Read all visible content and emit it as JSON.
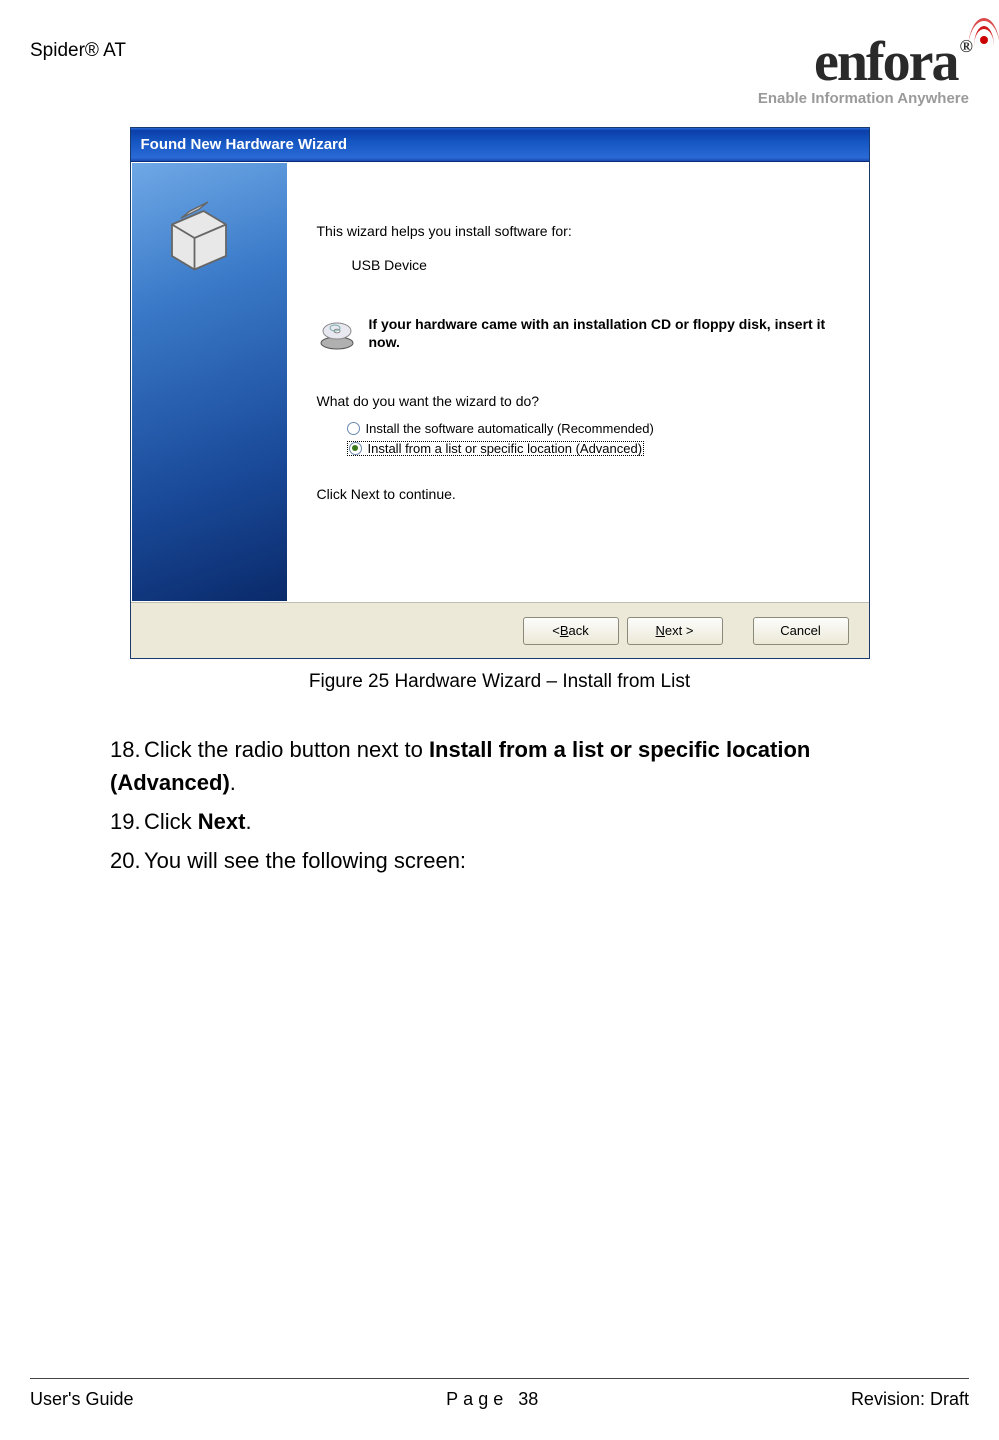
{
  "header": {
    "product": "Spider® AT",
    "logo_text": "enfora",
    "logo_reg": "®",
    "logo_tagline": "Enable Information Anywhere"
  },
  "wizard": {
    "title": "Found New Hardware Wizard",
    "intro": "This wizard helps you install software for:",
    "device": "USB Device",
    "cd_text": "If your hardware came with an installation CD or floppy disk, insert it now.",
    "question": "What do you want the wizard to do?",
    "option_auto": "Install the software automatically (Recommended)",
    "option_list": "Install from a list or specific location (Advanced)",
    "continue": "Click Next to continue.",
    "btn_back_lt": "< ",
    "btn_back_b": "B",
    "btn_back_rest": "ack",
    "btn_next_n": "N",
    "btn_next_rest": "ext >",
    "btn_cancel": "Cancel"
  },
  "caption": "Figure 25 Hardware Wizard – Install from List",
  "steps": {
    "s18_num": "18.",
    "s18_pre": "Click the radio button next to ",
    "s18_bold": "Install from a list or specific location (Advanced)",
    "s18_post": ".",
    "s19_num": "19.",
    "s19_pre": "Click ",
    "s19_bold": "Next",
    "s19_post": ".",
    "s20_num": "20.",
    "s20_text": "You will see the following screen:"
  },
  "footer": {
    "left": "User's Guide",
    "mid_label": "Page ",
    "mid_num": "38",
    "right": "Revision: Draft"
  }
}
